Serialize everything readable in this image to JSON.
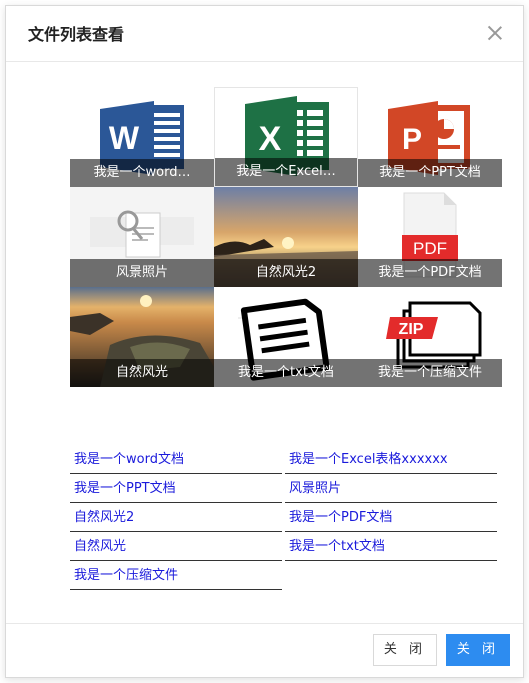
{
  "dialog": {
    "title": "文件列表查看"
  },
  "tiles": [
    {
      "caption": "我是一个word…",
      "icon": "word-icon"
    },
    {
      "caption": "我是一个Excel…",
      "icon": "excel-icon"
    },
    {
      "caption": "我是一个PPT文档",
      "icon": "ppt-icon"
    },
    {
      "caption": "风景照片",
      "icon": "image-placeholder-icon"
    },
    {
      "caption": "自然风光2",
      "icon": "sunset-photo"
    },
    {
      "caption": "我是一个PDF文档",
      "icon": "pdf-icon"
    },
    {
      "caption": "自然风光",
      "icon": "sunrise-photo"
    },
    {
      "caption": "我是一个txt文档",
      "icon": "txt-icon"
    },
    {
      "caption": "我是一个压缩文件",
      "icon": "zip-icon",
      "icon_text": "ZIP"
    }
  ],
  "pdf_label": "PDF",
  "links": [
    "我是一个word文档",
    "我是一个Excel表格xxxxxx",
    "我是一个PPT文档",
    "风景照片",
    "自然风光2",
    "我是一个PDF文档",
    "自然风光",
    "我是一个txt文档",
    "我是一个压缩文件"
  ],
  "footer": {
    "close_label": "关 闭",
    "primary_label": "关 闭"
  },
  "colors": {
    "primary": "#2d8cf0",
    "link": "#1a1adb",
    "word": "#2b5797",
    "excel": "#1e7145",
    "ppt": "#d24726",
    "pdf": "#e32b2b"
  }
}
